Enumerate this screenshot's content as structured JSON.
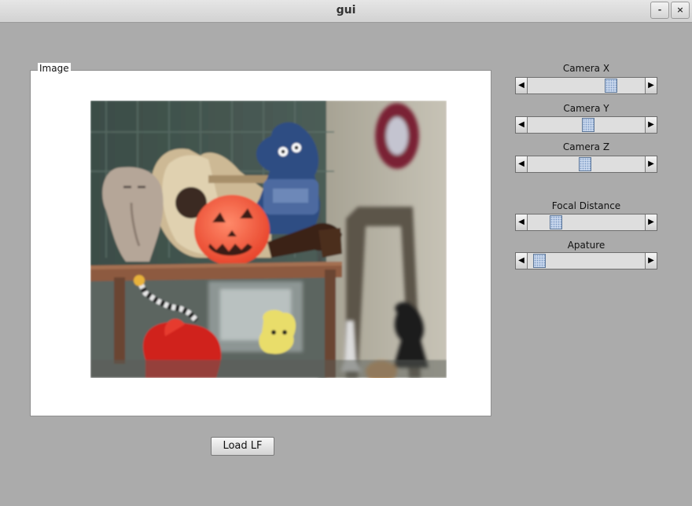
{
  "window": {
    "title": "gui",
    "minimize_label": "-",
    "close_label": "×"
  },
  "image_panel": {
    "legend": "Image"
  },
  "sliders": [
    {
      "label": "Camera X",
      "value": 0.74
    },
    {
      "label": "Camera Y",
      "value": 0.52
    },
    {
      "label": "Camera Z",
      "value": 0.49
    },
    {
      "label": "Focal Distance",
      "value": 0.21
    },
    {
      "label": "Apature",
      "value": 0.05
    }
  ],
  "arrows": {
    "left": "◀",
    "right": "▶"
  },
  "load_button": {
    "label": "Load LF"
  },
  "colors": {
    "background": "#ababab",
    "thumb": "#c7d6ec"
  }
}
